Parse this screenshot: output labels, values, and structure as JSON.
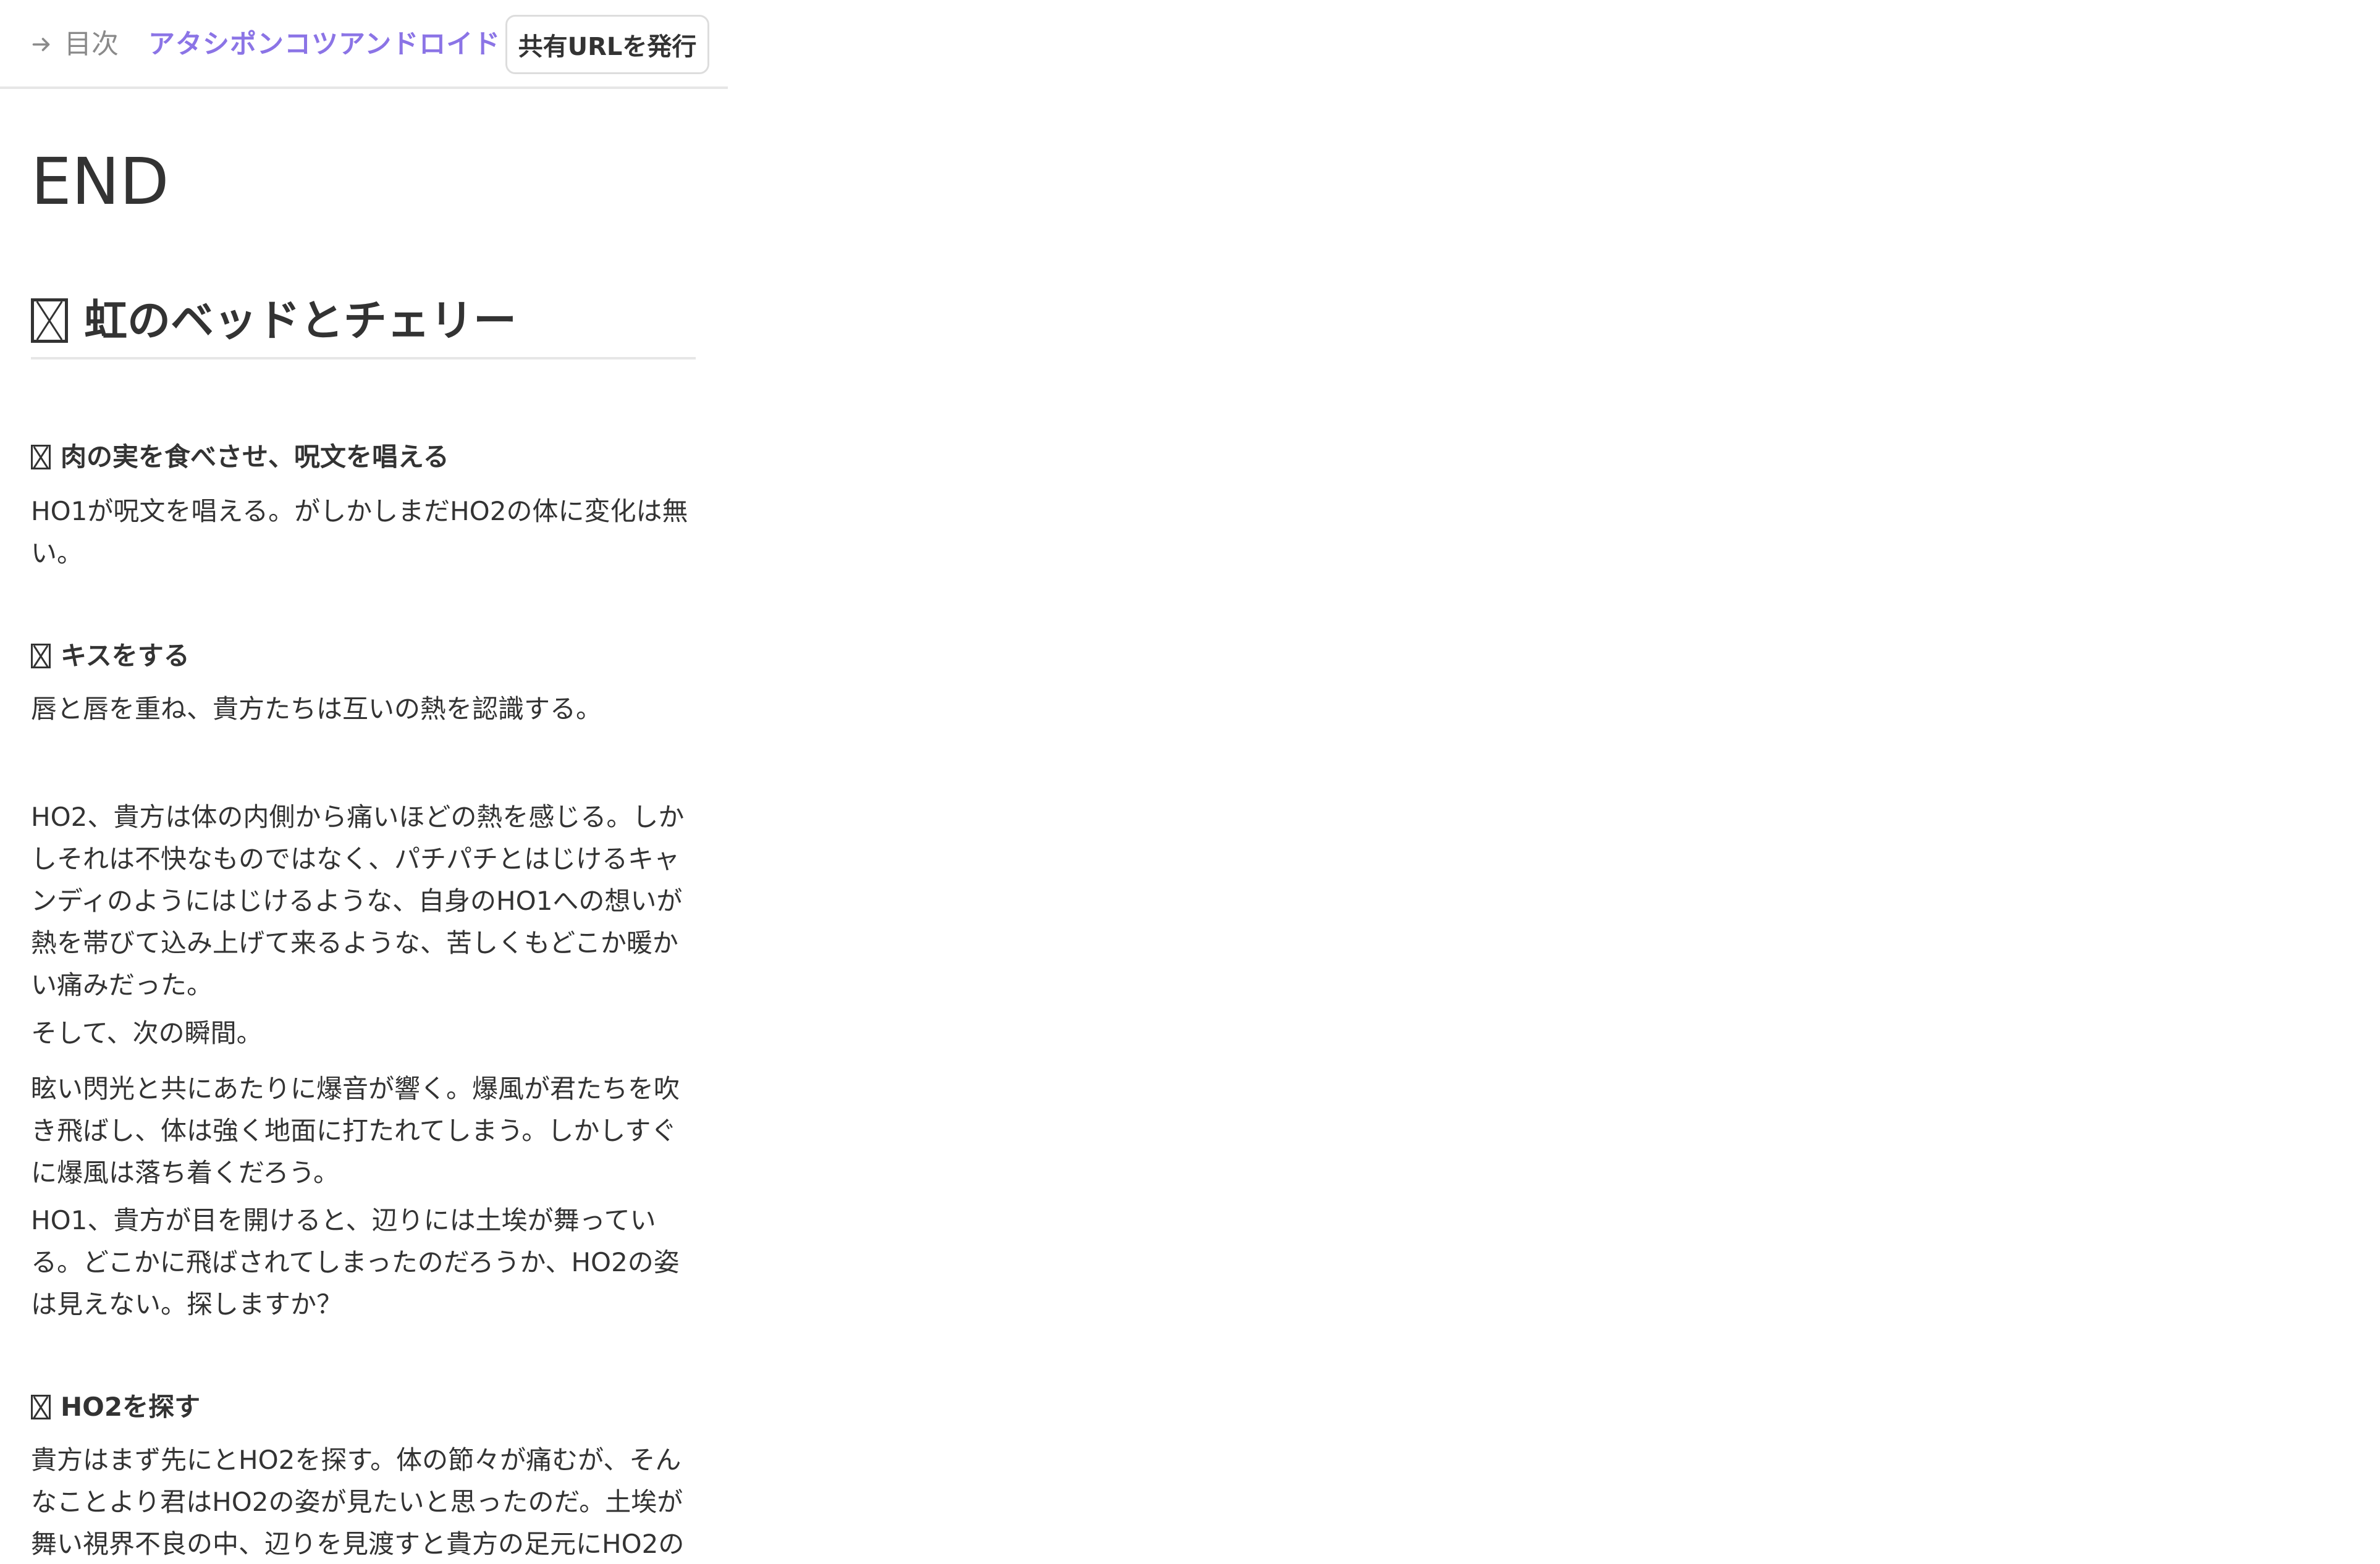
{
  "header": {
    "toc_label": "目次",
    "app_title": "アタシポンコツアンドロイド",
    "share_button_label": "共有URLを発行"
  },
  "content": {
    "end_title": "END",
    "section_title": "虹のベッドとチェリー",
    "choice_1": "肉の実を食べさせ、呪文を唱える",
    "para_1": "HO1が呪文を唱える。がしかしまだHO2の体に変化は無\nい。",
    "choice_2": "キスをする",
    "para_2": "唇と唇を重ね、貴方たちは互いの熱を認識する。",
    "para_3": "HO2、貴方は体の内側から痛いほどの熱を感じる。しか\nしそれは不快なものではなく、パチパチとはじけるキャ\nンディのようにはじけるような、自身のHO1への想いが\n熱を帯びて込み上げて来るような、苦しくもどこか暖か\nい痛みだった。",
    "para_4": "そして、次の瞬間。",
    "para_5": "眩い閃光と共にあたりに爆音が響く。爆風が君たちを吹\nき飛ばし、体は強く地面に打たれてしまう。しかしすぐ\nに爆風は落ち着くだろう。",
    "para_6": "HO1、貴方が目を開けると、辺りには土埃が舞ってい\nる。どこかに飛ばされてしまったのだろうか、HO2の姿\nは見えない。探しますか？",
    "choice_3": "HO2を探す",
    "para_7": "貴方はまず先にとHO2を探す。体の節々が痛むが、そん\nなことより君はHO2の姿が見たいと思ったのだ。土埃が\n舞い視界不良の中、辺りを見渡すと貴方の足元にHO2の"
  }
}
